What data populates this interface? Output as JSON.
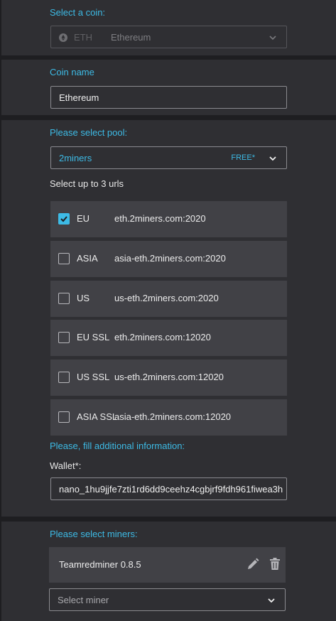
{
  "coin_select": {
    "label": "Select a coin:",
    "ticker": "ETH",
    "name": "Ethereum"
  },
  "coin_name": {
    "label": "Coin name",
    "value": "Ethereum"
  },
  "pool": {
    "label": "Please select pool:",
    "value": "2miners",
    "badge": "FREE*",
    "urls_label": "Select up to 3 urls",
    "urls": [
      {
        "region": "EU",
        "host": "eth.2miners.com:2020",
        "checked": true
      },
      {
        "region": "ASIA",
        "host": "asia-eth.2miners.com:2020",
        "checked": false
      },
      {
        "region": "US",
        "host": "us-eth.2miners.com:2020",
        "checked": false
      },
      {
        "region": "EU SSL",
        "host": "eth.2miners.com:12020",
        "checked": false
      },
      {
        "region": "US SSL",
        "host": "us-eth.2miners.com:12020",
        "checked": false
      },
      {
        "region": "ASIA SSL",
        "host": "asia-eth.2miners.com:12020",
        "checked": false
      }
    ]
  },
  "additional": {
    "label": "Please, fill additional information:",
    "wallet_label": "Wallet*:",
    "wallet_value": "nano_1hu9jjfe7zti1rd6dd9ceehz4cgbjrf9fdh961fiwea3h"
  },
  "miners": {
    "label": "Please select miners:",
    "items": [
      {
        "name": "Teamredminer 0.8.5"
      }
    ],
    "select_placeholder": "Select miner"
  },
  "colors": {
    "accent": "#3dbbe6",
    "panel": "#2f2f33",
    "row": "#414146",
    "background": "#1e1e21"
  }
}
